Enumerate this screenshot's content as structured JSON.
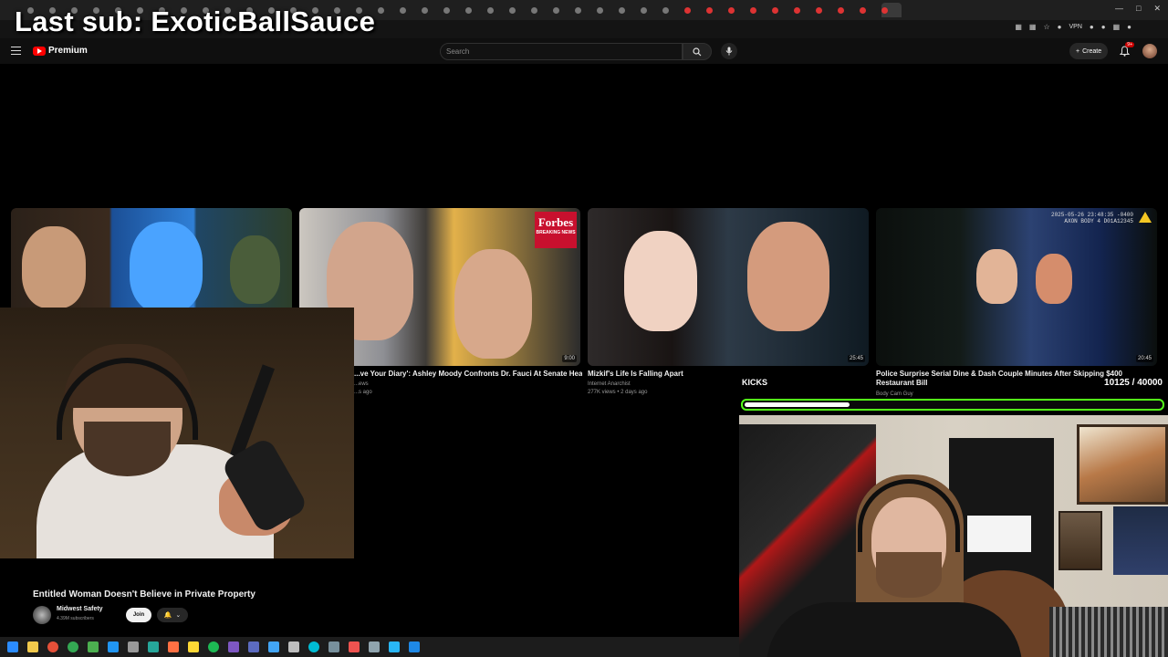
{
  "overlay": {
    "last_sub": "Last sub: ExoticBallSauce"
  },
  "youtube": {
    "brand": "Premium",
    "search_placeholder": "Search",
    "create_label": "Create",
    "notification_count": "9+"
  },
  "browser": {
    "vpn_label": "VPN"
  },
  "videos": [
    {
      "title": "",
      "meta1": "",
      "meta2": "",
      "duration": ""
    },
    {
      "title": "...ve Your Diary': Ashley Moody Confronts Dr. Fauci At Senate Hearing",
      "meta1": "...ews",
      "meta2": "...s ago",
      "duration": "9:00",
      "badge_line1": "Forbes",
      "badge_line2": "BREAKING NEWS"
    },
    {
      "title": "Mizkif's Life Is Falling Apart",
      "meta1": "Internet Anarchist",
      "meta2": "277K views • 2 days ago",
      "duration": "25:45"
    },
    {
      "title": "Police Surprise Serial Dine & Dash Couple Minutes After Skipping $400 Restaurant Bill",
      "meta1": "Body Cam Guy",
      "meta2": "",
      "duration": "20:45",
      "stamp_line1": "2025-05-26 23:48:35 -0400",
      "stamp_line2": "AXON BODY 4 D01A12345"
    }
  ],
  "current_video": {
    "title": "Entitled Woman Doesn't Believe in Private Property",
    "channel": "Midwest Safety",
    "subscribers": "4.39M subscribers",
    "join_label": "Join"
  },
  "kicks_goal": {
    "label": "KICKS",
    "count": "10125 / 40000",
    "progress_fraction": 0.253,
    "accent": "#53fc18"
  },
  "icons": {
    "menu": "hamburger-icon",
    "search": "search-icon",
    "mic": "mic-icon",
    "bell": "bell-icon",
    "windows": "windows-start-icon"
  }
}
